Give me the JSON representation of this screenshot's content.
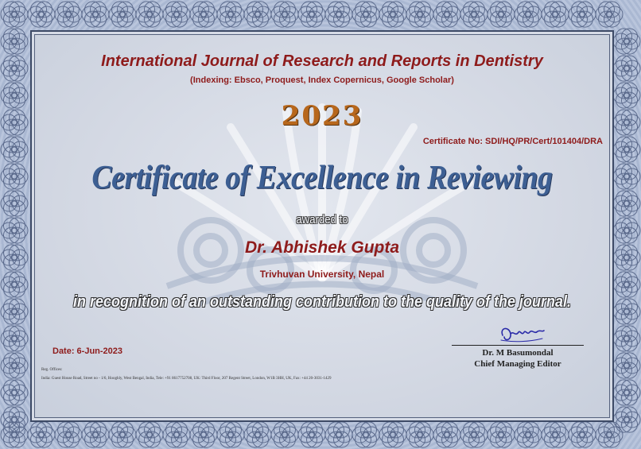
{
  "certificate": {
    "journal_title": "International Journal of Research and Reports in Dentistry",
    "indexing": "(Indexing: Ebsco, Proquest, Index Copernicus, Google Scholar)",
    "year": "2023",
    "certificate_no": "Certificate No: SDI/HQ/PR/Cert/101404/DRA",
    "title": "Certificate of Excellence in Reviewing",
    "awarded_to": "awarded to",
    "recipient": "Dr. Abhishek Gupta",
    "affiliation": "Trivhuvan University, Nepal",
    "recognition": "in recognition of an outstanding contribution to the quality of the journal.",
    "date": "Date: 6-Jun-2023",
    "editor_name": "Dr. M  Basumondal",
    "editor_title": "Chief Managing Editor",
    "reg_offices_label": "Reg. Offices:",
    "address": "India: Guest House Road, Street no - 1/6, Hooghly, West Bengal, India, Tele: +91 8617752708, UK: Third Floor, 207 Regent Street, London, W1B 3HH, UK, Fax: +44 20-3031-1429"
  },
  "colors": {
    "accent_red": "#8e1b1b",
    "title_blue": "#3d5f93",
    "year_orange": "#b7671c",
    "border_navy": "#3d4a66",
    "background": "#d3d8e3"
  },
  "icons": {
    "signature": "handwritten-signature",
    "border": "guilloche-rosette-border",
    "watermark": "ornamental-fan-watermark"
  }
}
